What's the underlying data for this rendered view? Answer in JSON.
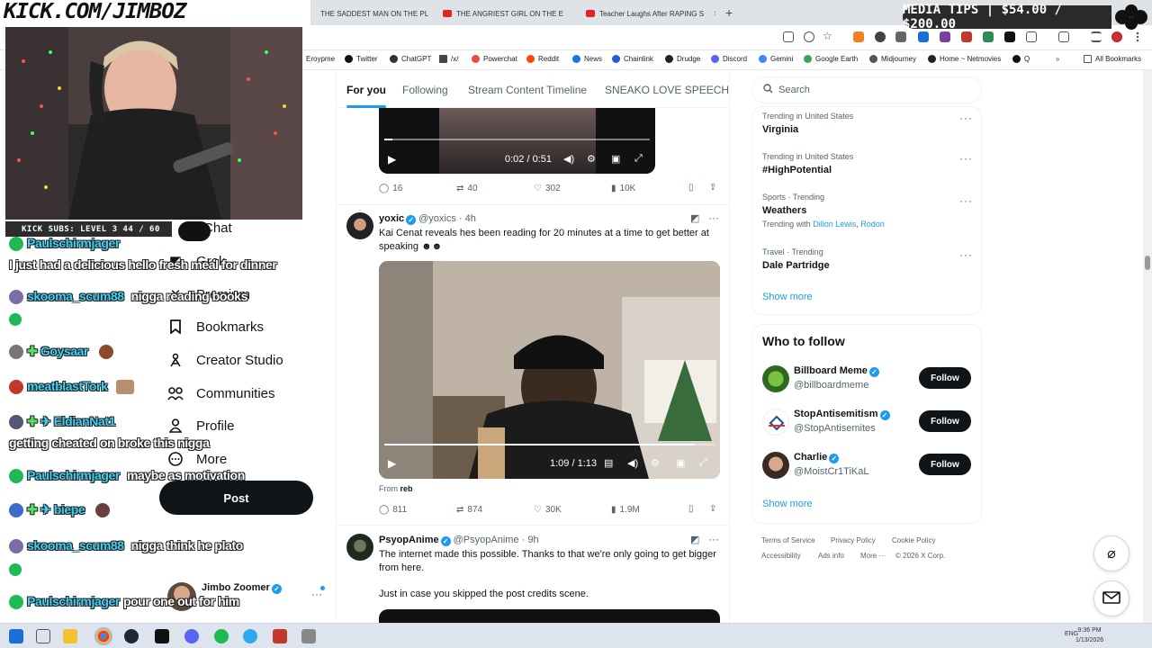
{
  "browser": {
    "tabs": [
      {
        "label": "THE SADDEST MAN ON THE PL"
      },
      {
        "label": "THE ANGRIEST GIRL ON THE E"
      },
      {
        "label": "Teacher Laughs After RAPING S"
      }
    ],
    "bookmarks": [
      "Eroypme",
      "Twitter",
      "ChatGPT",
      "/x/",
      "Powerchat",
      "Reddit",
      "News",
      "Chainlink",
      "Drudge",
      "Discord",
      "Gemini",
      "Google Earth",
      "Midjourney",
      "Home ~ Netmovies",
      "Q"
    ],
    "all_bookmarks": "All Bookmarks"
  },
  "overlay": {
    "banner": "KICK.COM/JIMBOZ",
    "donation": "MEDIA TIPS | $54.00 / $200.00",
    "kick_subs": "KICK SUBS: LEVEL 3 44 / 60"
  },
  "chat": [
    {
      "name": "Paulschirmjager",
      "msg": ""
    },
    {
      "name": "",
      "msg": "I just had a delicious hello fresh meal for dinner"
    },
    {
      "name": "skooma_scum88",
      "msg": "nigga reading books"
    },
    {
      "name": "Goysaar",
      "msg": ""
    },
    {
      "name": "meatblastTork",
      "msg": ""
    },
    {
      "name": "EldianNat1",
      "msg": ""
    },
    {
      "name": "",
      "msg": "getting cheated on broke this nigga"
    },
    {
      "name": "Paulschirmjager",
      "msg": "maybe as motivation"
    },
    {
      "name": "biepe",
      "msg": ""
    },
    {
      "name": "skooma_scum88",
      "msg": "nigga think he plato"
    },
    {
      "name": "Paulschirmjager",
      "msg": "pour one out for him"
    }
  ],
  "nav": {
    "items": [
      "Chat",
      "Grok",
      "Premium",
      "Bookmarks",
      "Creator Studio",
      "Communities",
      "Profile",
      "More"
    ],
    "post_label": "Post",
    "account_name": "Jimbo Zoomer"
  },
  "feed": {
    "tabs": [
      "For you",
      "Following",
      "Stream Content Timeline",
      "SNEAKO LOVE SPEECH"
    ],
    "post1": {
      "video_time": "0:02 / 0:51",
      "replies": "16",
      "reposts": "40",
      "likes": "302",
      "views": "10K"
    },
    "post2": {
      "name": "yoxic",
      "handle": "@yoxics",
      "time": "· 4h",
      "text": "Kai Cenat reveals hes been reading for 20 minutes at a time to get better at speaking ☻☻",
      "video_time": "1:09 / 1:13",
      "from_label": "From",
      "from_user": "reb",
      "replies": "811",
      "reposts": "874",
      "likes": "30K",
      "views": "1.9M"
    },
    "post3": {
      "name": "PsyopAnime",
      "handle": "@PsyopAnime",
      "time": "· 9h",
      "text1": "The internet made this possible.  Thanks to that we're only going to get bigger from here.",
      "text2": "Just in case you skipped the post credits scene."
    }
  },
  "sidebar": {
    "search_placeholder": "Search",
    "trends": [
      {
        "meta": "Trending in United States",
        "title": "Virginia",
        "with": ""
      },
      {
        "meta": "Trending in United States",
        "title": "#HighPotential",
        "with": ""
      },
      {
        "meta": "Sports · Trending",
        "title": "Weathers",
        "with_label": "Trending with",
        "with_a": "Dillon Lewis",
        "with_b": "Rodon"
      },
      {
        "meta": "Travel · Trending",
        "title": "Dale Partridge",
        "with": ""
      }
    ],
    "show_more": "Show more",
    "who_to_follow": "Who to follow",
    "follow": [
      {
        "name": "Billboard Meme",
        "handle": "@billboardmeme"
      },
      {
        "name": "StopAntisemitism",
        "handle": "@StopAntisemites"
      },
      {
        "name": "Charlie",
        "handle": "@MoistCr1TiKaL"
      }
    ],
    "follow_label": "Follow",
    "footer": [
      "Terms of Service",
      "Privacy Policy",
      "Cookie Policy",
      "Accessibility",
      "Ads info",
      "More ···",
      "© 2026 X Corp."
    ]
  },
  "taskbar": {
    "lang": "ENG",
    "time": "9:36 PM",
    "date": "1/13/2026"
  }
}
